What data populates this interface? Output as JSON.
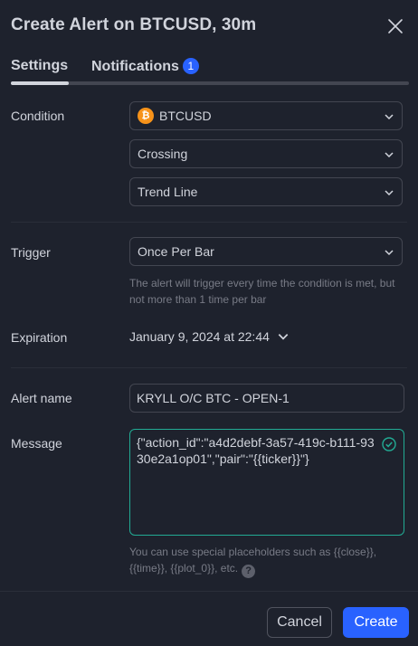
{
  "header": {
    "title": "Create Alert on BTCUSD, 30m"
  },
  "tabs": [
    {
      "label": "Settings",
      "active": true
    },
    {
      "label": "Notifications",
      "badge": "1"
    }
  ],
  "condition": {
    "label": "Condition",
    "symbol": {
      "icon": "bitcoin-icon",
      "icon_glyph": "₿",
      "value": "BTCUSD"
    },
    "operator": "Crossing",
    "target": "Trend Line"
  },
  "trigger": {
    "label": "Trigger",
    "value": "Once Per Bar",
    "hint": "The alert will trigger every time the condition is met, but not more than 1 time per bar"
  },
  "expiration": {
    "label": "Expiration",
    "value": "January 9, 2024 at 22:44"
  },
  "alert_name": {
    "label": "Alert name",
    "value": "KRYLL O/C BTC - OPEN-1"
  },
  "message": {
    "label": "Message",
    "value": "{\"action_id\":\"a4d2debf-3a57-419c-b111-9330e2a1op01\",\"pair\":\"{{ticker}}\"}",
    "hint": "You can use special placeholders such as {{close}}, {{time}}, {{plot_0}}, etc.",
    "help_glyph": "?"
  },
  "footer": {
    "cancel_label": "Cancel",
    "create_label": "Create"
  },
  "colors": {
    "background": "#1e222d",
    "accent": "#2962ff",
    "valid": "#22ab94",
    "bitcoin": "#f7931a"
  }
}
